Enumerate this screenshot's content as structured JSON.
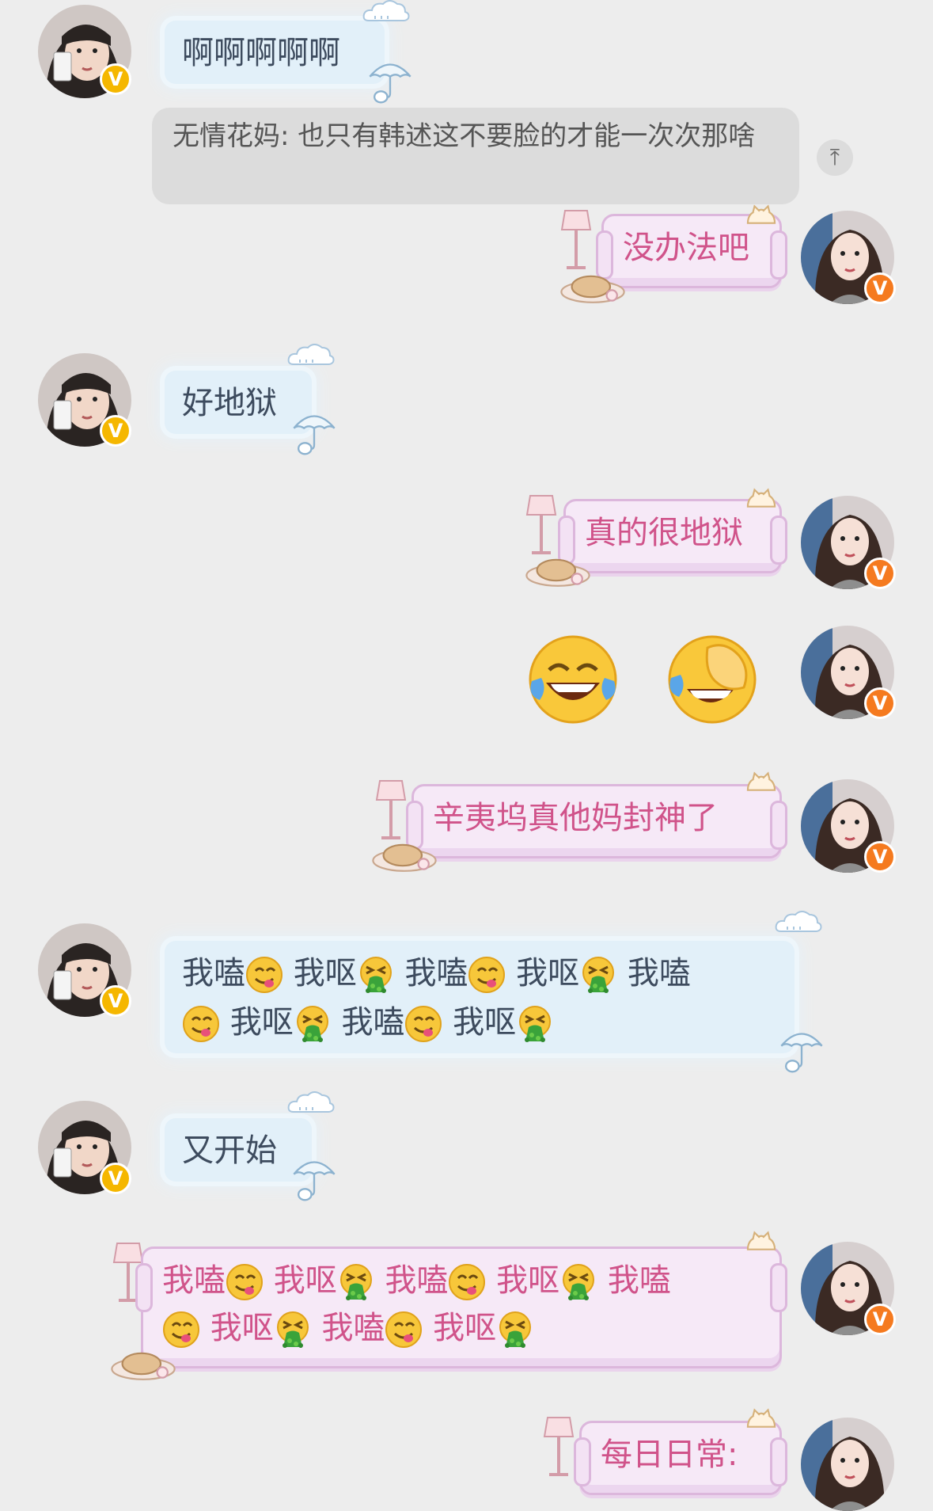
{
  "messages": [
    {
      "side": "left",
      "text": "啊啊啊啊啊"
    },
    {
      "side": "quote",
      "text": "无情花妈: 也只有韩述这不要脸的才能一次次那啥",
      "button_icon": "arrow-up-icon"
    },
    {
      "side": "right",
      "text": "没办法吧"
    },
    {
      "side": "left",
      "text": "好地狱"
    },
    {
      "side": "right",
      "text": "真的很地狱"
    },
    {
      "side": "right-emoji",
      "emojis": [
        "tears-of-joy-emoji",
        "facepalm-crying-emoji"
      ]
    },
    {
      "side": "right",
      "text": "辛夷坞真他妈封神了"
    },
    {
      "side": "left",
      "segments": [
        "我嗑",
        "我呕",
        "我嗑",
        "我呕",
        "我嗑",
        "我呕",
        "我嗑",
        "我呕"
      ]
    },
    {
      "side": "left",
      "text": "又开始"
    },
    {
      "side": "right",
      "segments": [
        "我嗑",
        "我呕",
        "我嗑",
        "我呕",
        "我嗑",
        "我呕",
        "我嗑",
        "我呕"
      ]
    },
    {
      "side": "right",
      "text": "每日日常:"
    }
  ],
  "badges": {
    "left": "V",
    "right": "V"
  },
  "colors": {
    "background": "#ededed",
    "left_badge": "#f5b700",
    "right_badge": "#f57a1f",
    "right_text": "#d0538a",
    "left_text": "#3d4b5e"
  }
}
